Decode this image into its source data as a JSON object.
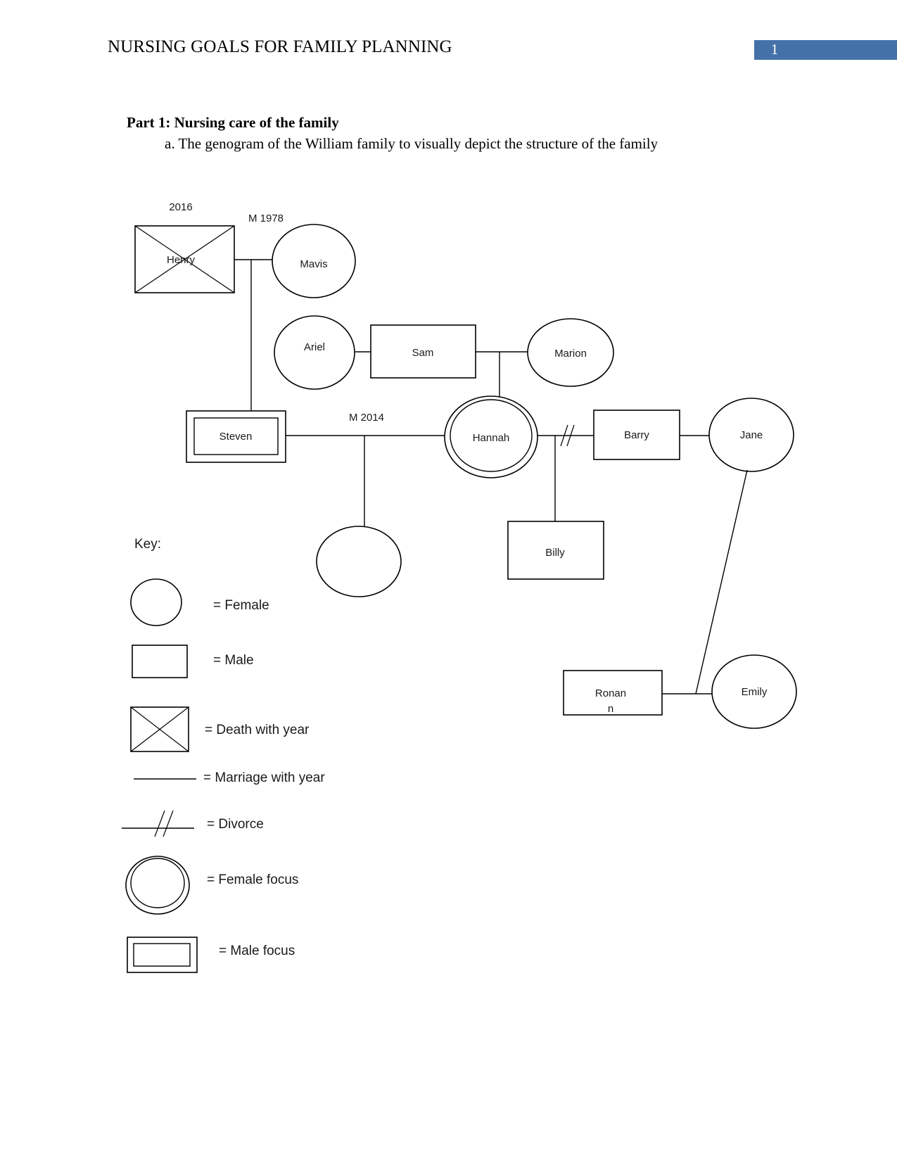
{
  "header": {
    "title": "NURSING GOALS FOR FAMILY PLANNING",
    "page_number": "1",
    "badge_color": "#4472a8"
  },
  "body": {
    "part_heading": "Part 1: Nursing care of the family",
    "paragraph": "a. The genogram of the William family to visually depict the structure of the family"
  },
  "genogram": {
    "persons": {
      "henry": "Henry",
      "mavis": "Mavis",
      "ariel": "Ariel",
      "sam": "Sam",
      "marion": "Marion",
      "steven": "Steven",
      "hannah": "Hannah",
      "barry": "Barry",
      "jane": "Jane",
      "billy": "Billy",
      "ronan_line1": "Ronan",
      "ronan_line2": "n",
      "emily": "Emily",
      "unnamed_daughter": ""
    },
    "annotations": {
      "henry_death_year": "2016",
      "henry_mavis_marriage": "M 1978",
      "steven_hannah_marriage": "M 2014"
    }
  },
  "key": {
    "title": "Key:",
    "items": [
      {
        "symbol": "circle",
        "label": "= Female"
      },
      {
        "symbol": "square",
        "label": "= Male"
      },
      {
        "symbol": "square-x",
        "label": "= Death with year"
      },
      {
        "symbol": "line",
        "label": "= Marriage with year"
      },
      {
        "symbol": "line-double-slash",
        "label": "= Divorce"
      },
      {
        "symbol": "double-circle",
        "label": "= Female focus"
      },
      {
        "symbol": "double-square",
        "label": "= Male focus"
      }
    ]
  }
}
